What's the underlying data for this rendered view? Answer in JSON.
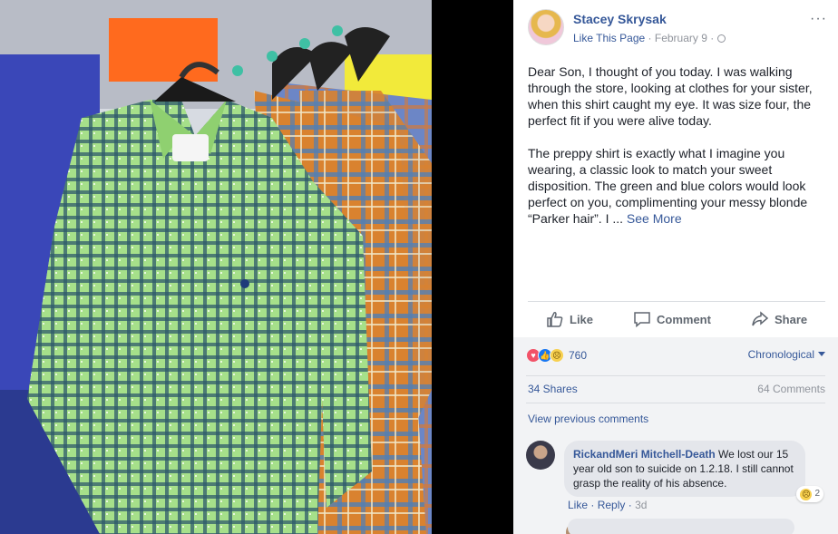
{
  "post": {
    "author": "Stacey Skrysak",
    "like_page": "Like This Page",
    "date": "February 9",
    "body_p1": "Dear Son, I thought of you today. I was walking through the store, looking at clothes for your sister, when this shirt caught my eye. It was size four, the perfect fit if you were alive today.",
    "body_p2": "The preppy shirt is exactly what I imagine you wearing, a classic look to match your sweet disposition. The green and blue colors would look perfect on you, complimenting your messy blonde “Parker hair”. I ...",
    "see_more": "See More",
    "more_icon": "more-options-icon"
  },
  "actions": {
    "like": "Like",
    "comment": "Comment",
    "share": "Share"
  },
  "stats": {
    "reaction_count": "760",
    "sort_label": "Chronological",
    "shares": "34 Shares",
    "comments": "64 Comments",
    "view_previous": "View previous comments"
  },
  "comment": {
    "author": "RickandMeri Mitchell-Death",
    "text": "We lost our 15 year old son to suicide on 1.2.18. I still cannot grasp the reality of his absence.",
    "like": "Like",
    "reply": "Reply",
    "time": "3d",
    "reaction_count": "2"
  },
  "colors": {
    "link": "#365899",
    "meta": "#90949c",
    "text": "#1d2129",
    "panel_bg": "#f2f3f5"
  }
}
